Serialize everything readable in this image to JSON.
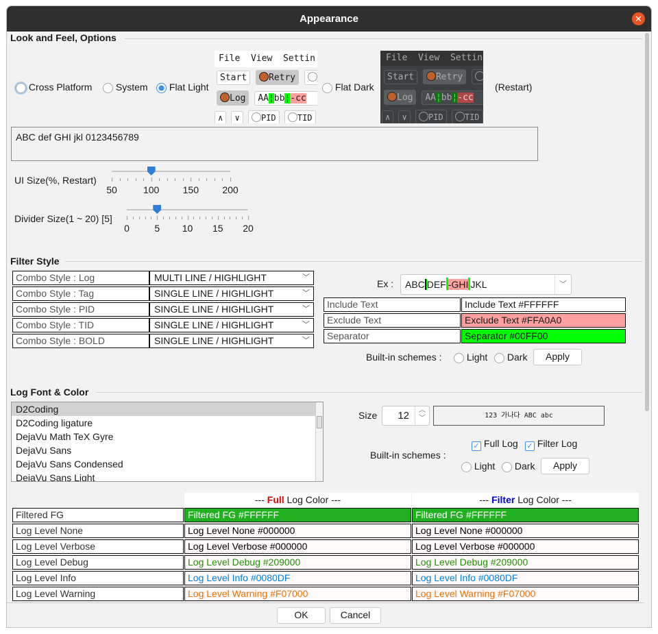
{
  "window": {
    "title": "Appearance"
  },
  "laf": {
    "section": "Look and Feel, Options",
    "options": [
      "Cross Platform",
      "System",
      "Flat Light",
      "Flat Dark"
    ],
    "selected": "Flat Light",
    "restart": "(Restart)",
    "preview": {
      "menu": [
        "File",
        "View",
        "Settin"
      ],
      "start": "Start",
      "retry": "Retry",
      "log": "Log",
      "sample": [
        "AA",
        "bb",
        "-cc"
      ],
      "up": "∧",
      "down": "∨",
      "pid": "PID",
      "tid": "TID"
    },
    "sample_text": "ABC def GHI jkl 0123456789",
    "ui_size": {
      "label": "UI Size(%, Restart)",
      "ticks": [
        "50",
        "100",
        "150",
        "200"
      ],
      "value": 100
    },
    "divider": {
      "label": "Divider Size(1 ~ 20) [5]",
      "ticks": [
        "0",
        "5",
        "10",
        "15",
        "20"
      ],
      "value": 5
    }
  },
  "filter": {
    "section": "Filter Style",
    "combos": [
      {
        "label": "Combo Style : Log",
        "value": "MULTI LINE / HIGHLIGHT"
      },
      {
        "label": "Combo Style : Tag",
        "value": "SINGLE LINE / HIGHLIGHT"
      },
      {
        "label": "Combo Style : PID",
        "value": "SINGLE LINE / HIGHLIGHT"
      },
      {
        "label": "Combo Style : TID",
        "value": "SINGLE LINE / HIGHLIGHT"
      },
      {
        "label": "Combo Style : BOLD",
        "value": "SINGLE LINE / HIGHLIGHT"
      }
    ],
    "ex_label": "Ex :",
    "ex_parts": [
      "ABC",
      "DEF",
      "-GHI",
      "JKL"
    ],
    "colors": [
      {
        "label": "Include Text",
        "value": "Include Text #FFFFFF",
        "bg": "#FFFFFF"
      },
      {
        "label": "Exclude Text",
        "value": "Exclude Text #FFA0A0",
        "bg": "#FFA0A0"
      },
      {
        "label": "Separator",
        "value": "Separator #00FF00",
        "bg": "#00FF00"
      }
    ],
    "schemes_label": "Built-in schemes :",
    "light": "Light",
    "dark": "Dark",
    "apply": "Apply"
  },
  "font": {
    "section": "Log Font & Color",
    "fonts": [
      "D2Coding",
      "D2Coding ligature",
      "DejaVu Math TeX Gyre",
      "DejaVu Sans",
      "DejaVu Sans Condensed",
      "DejaVu Sans Light"
    ],
    "selected": "D2Coding",
    "size_label": "Size",
    "size": "12",
    "preview": "123 가나다 ABC abc",
    "full_log": "Full Log",
    "filter_log": "Filter Log",
    "schemes_label": "Built-in schemes :",
    "light": "Light",
    "dark": "Dark",
    "apply": "Apply"
  },
  "log_colors": {
    "header_full": [
      "--- ",
      "Full",
      " Log Color ---"
    ],
    "header_filter": [
      "--- ",
      "Filter",
      " Log Color ---"
    ],
    "rows": [
      {
        "label": "Filtered FG",
        "full": "Filtered FG #FFFFFF",
        "filter": "Filtered FG #FFFFFF",
        "fg": "#FFFFFF",
        "bg": "#20B020"
      },
      {
        "label": "Log Level None",
        "full": "Log Level None #000000",
        "filter": "Log Level None #000000",
        "fg": "#000000",
        "bg": "#FFFAFA"
      },
      {
        "label": "Log Level Verbose",
        "full": "Log Level Verbose #000000",
        "filter": "Log Level Verbose #000000",
        "fg": "#000000",
        "bg": "#FFFAFA"
      },
      {
        "label": "Log Level Debug",
        "full": "Log Level Debug #209000",
        "filter": "Log Level Debug #209000",
        "fg": "#209000",
        "bg": "#FFFAFA"
      },
      {
        "label": "Log Level Info",
        "full": "Log Level Info #0080DF",
        "filter": "Log Level Info #0080DF",
        "fg": "#0080DF",
        "bg": "#FFFAFA"
      },
      {
        "label": "Log Level Warning",
        "full": "Log Level Warning #F07000",
        "filter": "Log Level Warning #F07000",
        "fg": "#F07000",
        "bg": "#FFFAFA"
      }
    ]
  },
  "buttons": {
    "ok": "OK",
    "cancel": "Cancel"
  }
}
